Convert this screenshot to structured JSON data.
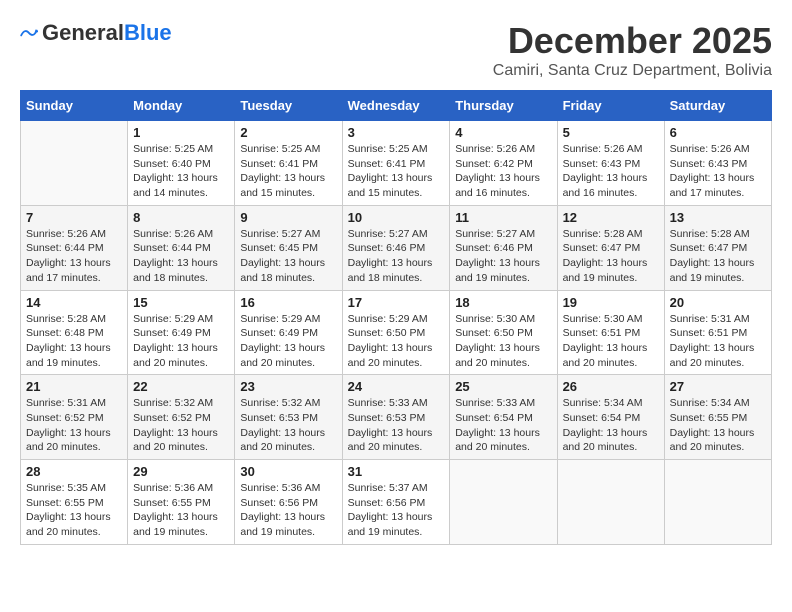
{
  "logo": {
    "line1": "General",
    "line2": "Blue"
  },
  "title": "December 2025",
  "subtitle": "Camiri, Santa Cruz Department, Bolivia",
  "days": [
    "Sunday",
    "Monday",
    "Tuesday",
    "Wednesday",
    "Thursday",
    "Friday",
    "Saturday"
  ],
  "weeks": [
    [
      {
        "num": "",
        "sunrise": "",
        "sunset": "",
        "daylight": ""
      },
      {
        "num": "1",
        "sunrise": "Sunrise: 5:25 AM",
        "sunset": "Sunset: 6:40 PM",
        "daylight": "Daylight: 13 hours and 14 minutes."
      },
      {
        "num": "2",
        "sunrise": "Sunrise: 5:25 AM",
        "sunset": "Sunset: 6:41 PM",
        "daylight": "Daylight: 13 hours and 15 minutes."
      },
      {
        "num": "3",
        "sunrise": "Sunrise: 5:25 AM",
        "sunset": "Sunset: 6:41 PM",
        "daylight": "Daylight: 13 hours and 15 minutes."
      },
      {
        "num": "4",
        "sunrise": "Sunrise: 5:26 AM",
        "sunset": "Sunset: 6:42 PM",
        "daylight": "Daylight: 13 hours and 16 minutes."
      },
      {
        "num": "5",
        "sunrise": "Sunrise: 5:26 AM",
        "sunset": "Sunset: 6:43 PM",
        "daylight": "Daylight: 13 hours and 16 minutes."
      },
      {
        "num": "6",
        "sunrise": "Sunrise: 5:26 AM",
        "sunset": "Sunset: 6:43 PM",
        "daylight": "Daylight: 13 hours and 17 minutes."
      }
    ],
    [
      {
        "num": "7",
        "sunrise": "Sunrise: 5:26 AM",
        "sunset": "Sunset: 6:44 PM",
        "daylight": "Daylight: 13 hours and 17 minutes."
      },
      {
        "num": "8",
        "sunrise": "Sunrise: 5:26 AM",
        "sunset": "Sunset: 6:44 PM",
        "daylight": "Daylight: 13 hours and 18 minutes."
      },
      {
        "num": "9",
        "sunrise": "Sunrise: 5:27 AM",
        "sunset": "Sunset: 6:45 PM",
        "daylight": "Daylight: 13 hours and 18 minutes."
      },
      {
        "num": "10",
        "sunrise": "Sunrise: 5:27 AM",
        "sunset": "Sunset: 6:46 PM",
        "daylight": "Daylight: 13 hours and 18 minutes."
      },
      {
        "num": "11",
        "sunrise": "Sunrise: 5:27 AM",
        "sunset": "Sunset: 6:46 PM",
        "daylight": "Daylight: 13 hours and 19 minutes."
      },
      {
        "num": "12",
        "sunrise": "Sunrise: 5:28 AM",
        "sunset": "Sunset: 6:47 PM",
        "daylight": "Daylight: 13 hours and 19 minutes."
      },
      {
        "num": "13",
        "sunrise": "Sunrise: 5:28 AM",
        "sunset": "Sunset: 6:47 PM",
        "daylight": "Daylight: 13 hours and 19 minutes."
      }
    ],
    [
      {
        "num": "14",
        "sunrise": "Sunrise: 5:28 AM",
        "sunset": "Sunset: 6:48 PM",
        "daylight": "Daylight: 13 hours and 19 minutes."
      },
      {
        "num": "15",
        "sunrise": "Sunrise: 5:29 AM",
        "sunset": "Sunset: 6:49 PM",
        "daylight": "Daylight: 13 hours and 20 minutes."
      },
      {
        "num": "16",
        "sunrise": "Sunrise: 5:29 AM",
        "sunset": "Sunset: 6:49 PM",
        "daylight": "Daylight: 13 hours and 20 minutes."
      },
      {
        "num": "17",
        "sunrise": "Sunrise: 5:29 AM",
        "sunset": "Sunset: 6:50 PM",
        "daylight": "Daylight: 13 hours and 20 minutes."
      },
      {
        "num": "18",
        "sunrise": "Sunrise: 5:30 AM",
        "sunset": "Sunset: 6:50 PM",
        "daylight": "Daylight: 13 hours and 20 minutes."
      },
      {
        "num": "19",
        "sunrise": "Sunrise: 5:30 AM",
        "sunset": "Sunset: 6:51 PM",
        "daylight": "Daylight: 13 hours and 20 minutes."
      },
      {
        "num": "20",
        "sunrise": "Sunrise: 5:31 AM",
        "sunset": "Sunset: 6:51 PM",
        "daylight": "Daylight: 13 hours and 20 minutes."
      }
    ],
    [
      {
        "num": "21",
        "sunrise": "Sunrise: 5:31 AM",
        "sunset": "Sunset: 6:52 PM",
        "daylight": "Daylight: 13 hours and 20 minutes."
      },
      {
        "num": "22",
        "sunrise": "Sunrise: 5:32 AM",
        "sunset": "Sunset: 6:52 PM",
        "daylight": "Daylight: 13 hours and 20 minutes."
      },
      {
        "num": "23",
        "sunrise": "Sunrise: 5:32 AM",
        "sunset": "Sunset: 6:53 PM",
        "daylight": "Daylight: 13 hours and 20 minutes."
      },
      {
        "num": "24",
        "sunrise": "Sunrise: 5:33 AM",
        "sunset": "Sunset: 6:53 PM",
        "daylight": "Daylight: 13 hours and 20 minutes."
      },
      {
        "num": "25",
        "sunrise": "Sunrise: 5:33 AM",
        "sunset": "Sunset: 6:54 PM",
        "daylight": "Daylight: 13 hours and 20 minutes."
      },
      {
        "num": "26",
        "sunrise": "Sunrise: 5:34 AM",
        "sunset": "Sunset: 6:54 PM",
        "daylight": "Daylight: 13 hours and 20 minutes."
      },
      {
        "num": "27",
        "sunrise": "Sunrise: 5:34 AM",
        "sunset": "Sunset: 6:55 PM",
        "daylight": "Daylight: 13 hours and 20 minutes."
      }
    ],
    [
      {
        "num": "28",
        "sunrise": "Sunrise: 5:35 AM",
        "sunset": "Sunset: 6:55 PM",
        "daylight": "Daylight: 13 hours and 20 minutes."
      },
      {
        "num": "29",
        "sunrise": "Sunrise: 5:36 AM",
        "sunset": "Sunset: 6:55 PM",
        "daylight": "Daylight: 13 hours and 19 minutes."
      },
      {
        "num": "30",
        "sunrise": "Sunrise: 5:36 AM",
        "sunset": "Sunset: 6:56 PM",
        "daylight": "Daylight: 13 hours and 19 minutes."
      },
      {
        "num": "31",
        "sunrise": "Sunrise: 5:37 AM",
        "sunset": "Sunset: 6:56 PM",
        "daylight": "Daylight: 13 hours and 19 minutes."
      },
      {
        "num": "",
        "sunrise": "",
        "sunset": "",
        "daylight": ""
      },
      {
        "num": "",
        "sunrise": "",
        "sunset": "",
        "daylight": ""
      },
      {
        "num": "",
        "sunrise": "",
        "sunset": "",
        "daylight": ""
      }
    ]
  ]
}
